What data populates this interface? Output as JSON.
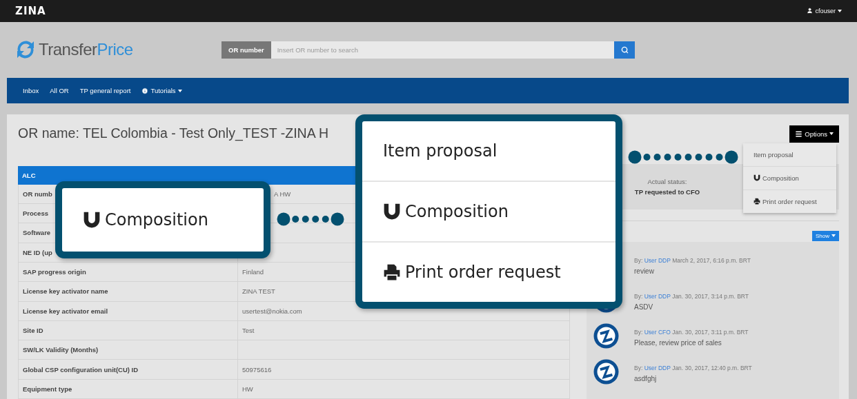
{
  "top_bar": {
    "brand": "ZINA",
    "user": "cfouser"
  },
  "header": {
    "logo": {
      "first": "Transfer",
      "second": "Price"
    },
    "search": {
      "label": "OR number",
      "placeholder": "Insert OR number to search"
    }
  },
  "nav": {
    "items": [
      {
        "label": "Inbox",
        "kind": "link"
      },
      {
        "label": "All OR",
        "kind": "link"
      },
      {
        "label": "TP general report",
        "kind": "link"
      },
      {
        "label": "Tutorials",
        "kind": "menu"
      }
    ]
  },
  "page": {
    "title": "OR name: TEL Colombia - Test Only_TEST -ZINA H",
    "table": {
      "header": "ALC",
      "rows": [
        {
          "label": "OR numb",
          "value": "A HW"
        },
        {
          "label": "Process"
        },
        {
          "label": "Software"
        },
        {
          "label": "NE ID (up"
        },
        {
          "label": "SAP progress origin",
          "value": "Finland"
        },
        {
          "label": "License key activator name",
          "value": "ZINA TEST"
        },
        {
          "label": "License key activator email",
          "value": "usertest@nokia.com"
        },
        {
          "label": "Site ID",
          "value": "Test"
        },
        {
          "label": "SW/LK Validity (Months)"
        },
        {
          "label": "Global CSP configuration unit(CU) ID",
          "value": "50975616"
        },
        {
          "label": "Equipment type",
          "value": "HW"
        }
      ]
    },
    "options": {
      "label": "Options",
      "menu": [
        {
          "label": "Item proposal",
          "kind": "plain"
        },
        {
          "label": "Composition",
          "kind": "magnet"
        },
        {
          "label": "Print order request",
          "kind": "print"
        }
      ]
    },
    "status": {
      "label": "Actual status:",
      "value": "TP requested to CFO"
    },
    "show_button": "Show",
    "comments": [
      {
        "by": "By:",
        "user": "User DDP",
        "date": "March 2, 2017, 6:16 p.m. BRT",
        "text": "review"
      },
      {
        "by": "By:",
        "user": "User DDP",
        "date": "Jan. 30, 2017, 3:14 p.m. BRT",
        "text": "ASDV"
      },
      {
        "by": "By:",
        "user": "User CFO",
        "date": "Jan. 30, 2017, 3:11 p.m. BRT",
        "text": "Please, review price of sales"
      },
      {
        "by": "By:",
        "user": "User DDP",
        "date": "Jan. 30, 2017, 12:40 p.m. BRT",
        "text": "asdfghj"
      }
    ]
  },
  "callouts": [
    {
      "kind": "small",
      "items": [
        {
          "label": "Composition",
          "kind": "magnet"
        }
      ]
    },
    {
      "kind": "large",
      "items": [
        {
          "label": "Item proposal",
          "kind": "plain"
        },
        {
          "label": "Composition",
          "kind": "magnet"
        },
        {
          "label": "Print order request",
          "kind": "print"
        }
      ]
    }
  ]
}
